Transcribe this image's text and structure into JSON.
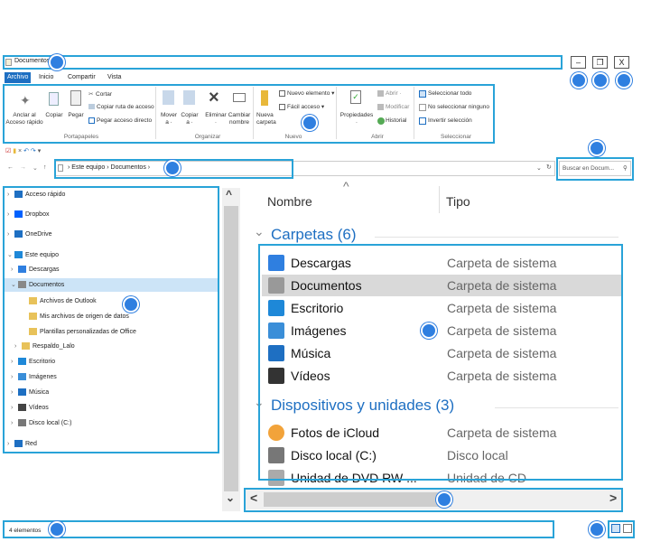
{
  "window": {
    "title": "Documentos",
    "minimize": "–",
    "maximize": "❐",
    "close": "X"
  },
  "tabs": [
    {
      "label": "Archivo",
      "active": true
    },
    {
      "label": "Inicio",
      "active": false
    },
    {
      "label": "Compartir",
      "active": false
    },
    {
      "label": "Vista",
      "active": false
    }
  ],
  "ribbon": {
    "pin_label_1": "Anclar al",
    "pin_label_2": "Acceso rápido",
    "copy": "Copiar",
    "paste": "Pegar",
    "cut": "Cortar",
    "copy_path": "Copiar ruta de acceso",
    "paste_shortcut": "Pegar acceso directo",
    "group_clipboard": "Portapapeles",
    "move_1": "Mover",
    "move_2": "a ·",
    "copy_to_1": "Copiar",
    "copy_to_2": "a ·",
    "delete_1": "Eliminar",
    "delete_2": "·",
    "rename_1": "Cambiar",
    "rename_2": "nombre",
    "group_organize": "Organizar",
    "new_folder_1": "Nueva",
    "new_folder_2": "carpeta",
    "new_item": "Nuevo elemento ▾",
    "easy_access": "Fácil acceso ▾",
    "group_new": "Nuevo",
    "properties_1": "Propiedades",
    "properties_2": "·",
    "open": "Abrir ·",
    "modify": "Modificar",
    "history": "Historial",
    "group_open": "Abrir",
    "select_all": "Seleccionar todo",
    "select_none": "No seleccionar ninguno",
    "invert_selection": "Invertir selección",
    "group_select": "Seleccionar"
  },
  "quick_access_toolbar": "▾",
  "address": {
    "path_root": "Este equipo",
    "path_sep": "›",
    "path_current": "Documentos",
    "search_placeholder": "Buscar en Docum..."
  },
  "nav_pane": [
    {
      "label": "Acceso rápido",
      "chev": "›",
      "icon": "star-icon",
      "color": "#1e6fc2"
    },
    {
      "label": "Dropbox",
      "chev": "›",
      "icon": "dropbox-icon",
      "color": "#0061fe"
    },
    {
      "label": "OneDrive",
      "chev": "›",
      "icon": "cloud-icon",
      "color": "#1e6fc2"
    },
    {
      "label": "Este equipo",
      "chev": "⌄",
      "icon": "computer-icon",
      "color": "#1e88d8"
    },
    {
      "label": "Descargas",
      "chev": "›",
      "icon": "download-icon",
      "color": "#2f7fe0"
    },
    {
      "label": "Documentos",
      "chev": "⌄",
      "icon": "document-icon",
      "color": "#888888"
    },
    {
      "label": "Archivos de Outlook",
      "chev": "",
      "icon": "folder-icon",
      "color": "#e8c25a"
    },
    {
      "label": "Mis archivos de origen de datos",
      "chev": "",
      "icon": "folder-icon",
      "color": "#e8c25a"
    },
    {
      "label": "Plantillas personalizadas de Office",
      "chev": "",
      "icon": "folder-icon",
      "color": "#e8c25a"
    },
    {
      "label": "Respaldo_Lalo",
      "chev": "›",
      "icon": "folder-icon",
      "color": "#e8c25a"
    },
    {
      "label": "Escritorio",
      "chev": "›",
      "icon": "desktop-icon",
      "color": "#1e88d8"
    },
    {
      "label": "Imágenes",
      "chev": "›",
      "icon": "picture-icon",
      "color": "#3a8ed8"
    },
    {
      "label": "Música",
      "chev": "›",
      "icon": "music-icon",
      "color": "#1e6fc2"
    },
    {
      "label": "Vídeos",
      "chev": "›",
      "icon": "video-icon",
      "color": "#444444"
    },
    {
      "label": "Disco local (C:)",
      "chev": "›",
      "icon": "drive-icon",
      "color": "#777777"
    },
    {
      "label": "Red",
      "chev": "›",
      "icon": "network-icon",
      "color": "#1e6fc2"
    }
  ],
  "content": {
    "col_name": "Nombre",
    "col_type": "Tipo",
    "sort_indicator": "^",
    "group_folders": "Carpetas (6)",
    "group_devices": "Dispositivos y unidades (3)",
    "group_chev": "⌄",
    "folders": [
      {
        "name": "Descargas",
        "type": "Carpeta de sistema",
        "icon": "download-icon"
      },
      {
        "name": "Documentos",
        "type": "Carpeta de sistema",
        "icon": "document-icon"
      },
      {
        "name": "Escritorio",
        "type": "Carpeta de sistema",
        "icon": "desktop-icon"
      },
      {
        "name": "Imágenes",
        "type": "Carpeta de sistema",
        "icon": "picture-icon"
      },
      {
        "name": "Música",
        "type": "Carpeta de sistema",
        "icon": "music-icon"
      },
      {
        "name": "Vídeos",
        "type": "Carpeta de sistema",
        "icon": "video-icon"
      }
    ],
    "devices": [
      {
        "name": "Fotos de iCloud",
        "type": "Carpeta de sistema",
        "icon": "icloud-photos-icon"
      },
      {
        "name": "Disco local (C:)",
        "type": "Disco local",
        "icon": "drive-icon"
      },
      {
        "name": "Unidad de DVD RW ...",
        "type": "Unidad de CD",
        "icon": "dvd-icon"
      }
    ]
  },
  "scroll": {
    "up": "^",
    "down": "⌄",
    "left": "<",
    "right": ">"
  },
  "status": {
    "count": "4 elementos"
  },
  "colors": {
    "accent": "#1e6fc2",
    "highlight": "#29a3d8",
    "marker": "#2f7fe0",
    "selected_row": "#d9d9d9",
    "selected_nav": "#cce4f7"
  }
}
